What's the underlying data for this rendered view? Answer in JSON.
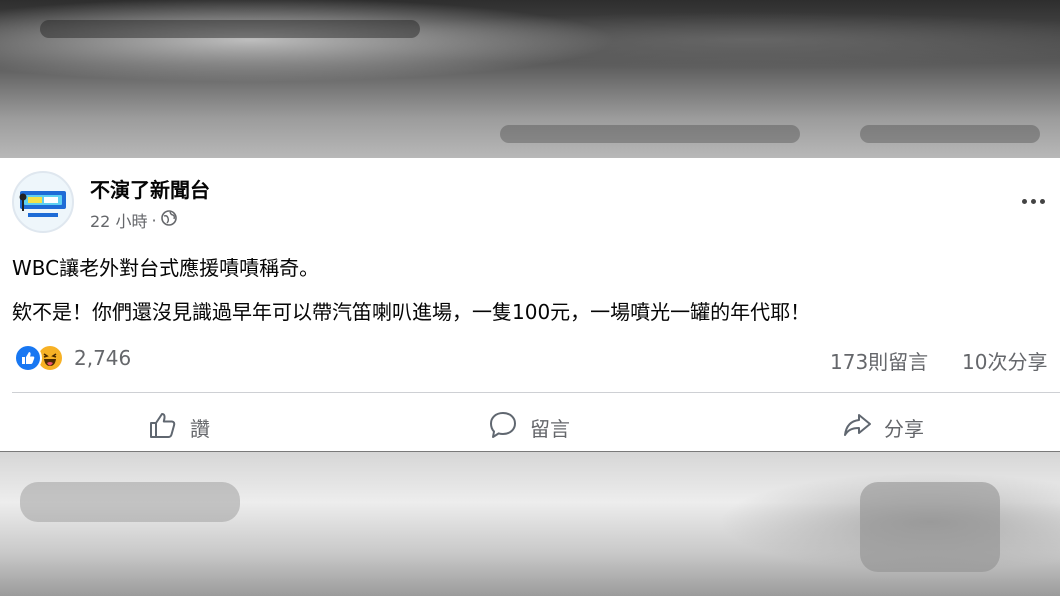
{
  "post": {
    "page_name": "不演了新聞台",
    "time": "22 小時",
    "separator": "·",
    "privacy_icon": "globe-icon",
    "more_icon": "more-horizontal-icon",
    "text_line_1": "WBC讓老外對台式應援嘖嘖稱奇。",
    "text_line_2": "欸不是！你們還沒見識過早年可以帶汽笛喇叭進場，一隻100元，一場噴光一罐的年代耶！"
  },
  "stats": {
    "reaction_icons": [
      "like-icon",
      "haha-icon"
    ],
    "reaction_count": "2,746",
    "comments": "173則留言",
    "shares": "10次分享"
  },
  "actions": {
    "like_label": "讚",
    "comment_label": "留言",
    "share_label": "分享"
  },
  "colors": {
    "like_blue": "#1877f2",
    "haha_yellow": "#f7b125",
    "secondary_text": "#65676b"
  }
}
